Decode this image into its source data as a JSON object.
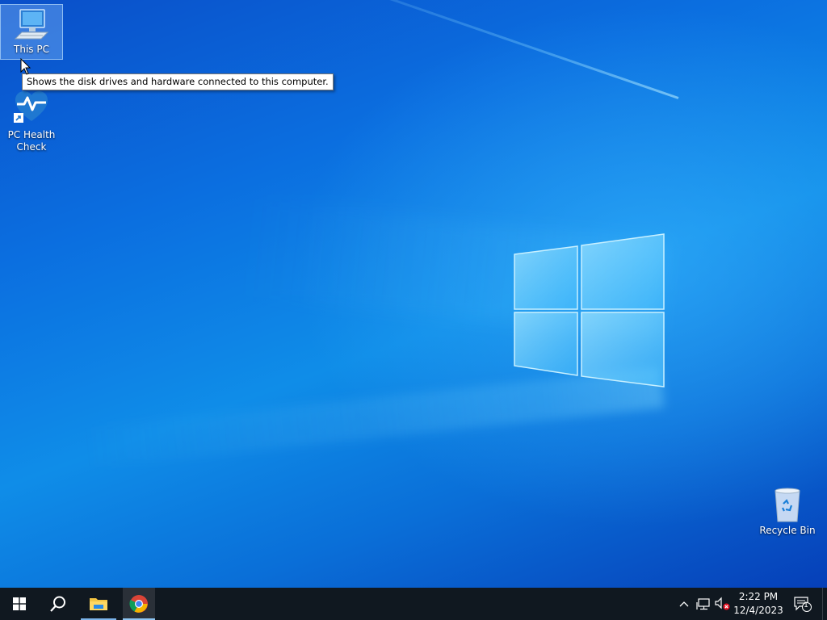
{
  "desktop": {
    "icons": [
      {
        "label": "This PC"
      },
      {
        "label": "PC Health Check"
      },
      {
        "label": "Recycle Bin"
      }
    ],
    "tooltip": "Shows the disk drives and hardware connected to this computer."
  },
  "taskbar": {
    "buttons": [
      {
        "name": "start",
        "icon": "windows-logo-icon"
      },
      {
        "name": "search",
        "icon": "search-icon"
      },
      {
        "name": "file-explorer",
        "icon": "folder-icon"
      },
      {
        "name": "chrome",
        "icon": "chrome-icon"
      }
    ],
    "tray": {
      "icons": [
        "chevron-up-icon",
        "network-icon",
        "volume-muted-icon"
      ],
      "time": "2:22 PM",
      "date": "12/4/2023",
      "notification_count": "1"
    }
  },
  "colors": {
    "taskbar_bg": "#101820",
    "desktop_accent": "#0b6fe0"
  }
}
